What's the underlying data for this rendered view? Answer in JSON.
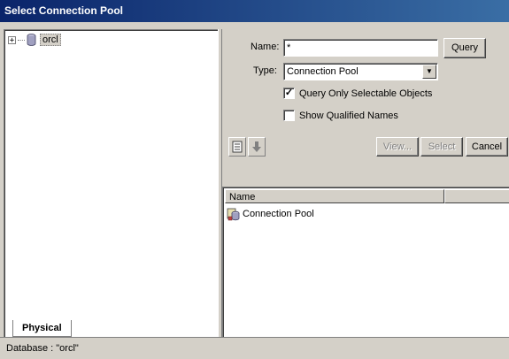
{
  "window": {
    "title": "Select Connection Pool"
  },
  "tree": {
    "expander": "+",
    "items": [
      {
        "label": "orcl",
        "icon": "database-icon"
      }
    ]
  },
  "tabs": {
    "physical": "Physical"
  },
  "form": {
    "name_label": "Name:",
    "name_value": "*",
    "query_button": "Query",
    "type_label": "Type:",
    "type_value": "Connection Pool",
    "query_only_label": "Query Only Selectable Objects",
    "query_only_checked": true,
    "show_qualified_label": "Show Qualified Names",
    "show_qualified_checked": false
  },
  "buttons": {
    "view": "View...",
    "select": "Select",
    "cancel": "Cancel"
  },
  "list": {
    "columns": [
      "Name",
      ""
    ],
    "rows": [
      {
        "name": "Connection Pool",
        "icon": "connection-pool-icon"
      }
    ]
  },
  "status": {
    "text": "Database : \"orcl\""
  }
}
